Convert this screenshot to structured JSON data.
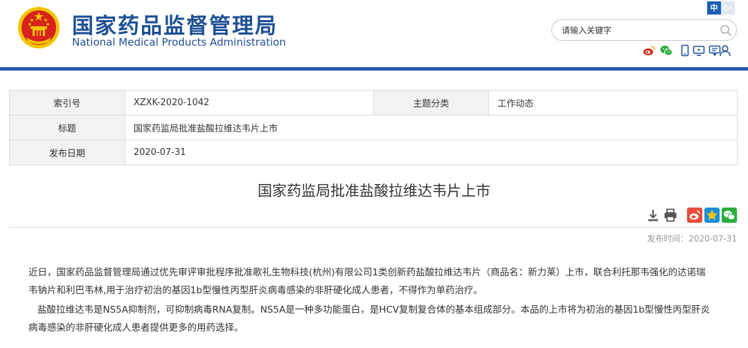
{
  "header": {
    "title_cn": "国家药品监督管理局",
    "title_en": "National Medical Products Administration",
    "lang_zh": "中",
    "lang_en": "En",
    "search_placeholder": "请输入关键字",
    "tool_icons": [
      "weibo-icon",
      "wechat-icon",
      "mobile-icon",
      "tv-icon",
      "message-icon",
      "user-icon"
    ]
  },
  "info": {
    "index_label": "索引号",
    "index_value": "XZXK-2020-1042",
    "category_label": "主题分类",
    "category_value": "工作动态",
    "title_label": "标题",
    "title_value": "国家药监局批准盐酸拉维达韦片上市",
    "date_label": "发布日期",
    "date_value": "2020-07-31"
  },
  "article": {
    "title": "国家药监局批准盐酸拉维达韦片上市",
    "publish_time": "发布时间：2020-07-31",
    "share_icons": [
      "download-icon",
      "print-icon",
      "weibo-share-icon",
      "qzone-share-icon",
      "wechat-share-icon"
    ],
    "para1_line1": "近日，国家药品监督管理局通过优先审评审批程序批准歌礼生物科技(杭州)有限公司1类创新药盐酸拉维达韦片（商品名：新力莱）上市，联合利托那韦强化的达诺瑞",
    "para1_line2": "韦钠片和利巴韦林,用于治疗初治的基因1b型慢性丙型肝炎病毒感染的非肝硬化成人患者，不得作为单药治疗。",
    "para2_line1": "盐酸拉维达韦是NS5A抑制剂，可抑制病毒RNA复制。NS5A是一种多功能蛋白，是HCV复制复合体的基本组成部分。本品的上市将为初治的基因1b型慢性丙型肝炎",
    "para2_line2": "病毒感染的非肝硬化成人患者提供更多的用药选择。"
  },
  "colors": {
    "brand_blue": "#1d4f96",
    "bar_blue": "#2b5ba8",
    "emblem_red": "#d7231c",
    "emblem_gold": "#f3c500"
  }
}
